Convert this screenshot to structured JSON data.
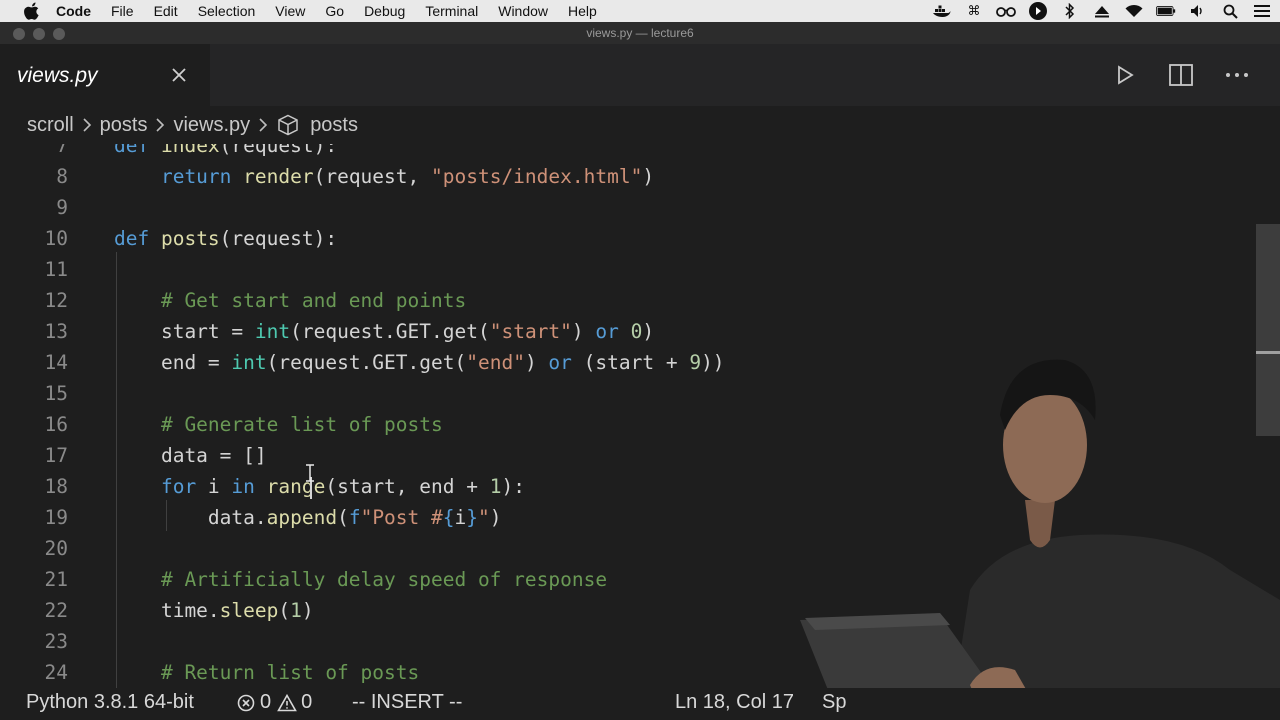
{
  "menubar": {
    "app_name": "Code",
    "items": [
      "File",
      "Edit",
      "Selection",
      "View",
      "Go",
      "Debug",
      "Terminal",
      "Window",
      "Help"
    ],
    "status_icons": [
      "docker-icon",
      "command-icon",
      "glasses-icon",
      "media-play-icon",
      "bluetooth-icon",
      "airplay-icon",
      "wifi-icon",
      "battery-icon",
      "volume-icon",
      "search-icon",
      "list-icon"
    ]
  },
  "window": {
    "title": "views.py — lecture6"
  },
  "tab": {
    "label": "views.py"
  },
  "breadcrumb": {
    "items": [
      "scroll",
      "posts",
      "views.py",
      "posts"
    ]
  },
  "editor": {
    "lines": [
      {
        "num": "7",
        "tokens": [
          [
            "kw",
            "def "
          ],
          [
            "fn",
            "index"
          ],
          [
            "",
            "(request):"
          ]
        ]
      },
      {
        "num": "8",
        "tokens": [
          [
            "kw",
            "    return "
          ],
          [
            "fn",
            "render"
          ],
          [
            "",
            "(request, "
          ],
          [
            "str",
            "\"posts/index.html\""
          ],
          [
            "",
            ")"
          ]
        ]
      },
      {
        "num": "9",
        "tokens": []
      },
      {
        "num": "10",
        "tokens": [
          [
            "kw",
            "def "
          ],
          [
            "fn",
            "posts"
          ],
          [
            "",
            "(request):"
          ]
        ]
      },
      {
        "num": "11",
        "tokens": []
      },
      {
        "num": "12",
        "tokens": [
          [
            "cmt",
            "    # Get start and end points"
          ]
        ]
      },
      {
        "num": "13",
        "tokens": [
          [
            "",
            "    start = "
          ],
          [
            "bi",
            "int"
          ],
          [
            "",
            "(request.GET.get("
          ],
          [
            "str",
            "\"start\""
          ],
          [
            "",
            ") "
          ],
          [
            "kw",
            "or"
          ],
          [
            "",
            " "
          ],
          [
            "num",
            "0"
          ],
          [
            "",
            ")"
          ]
        ]
      },
      {
        "num": "14",
        "tokens": [
          [
            "",
            "    end = "
          ],
          [
            "bi",
            "int"
          ],
          [
            "",
            "(request.GET.get("
          ],
          [
            "str",
            "\"end\""
          ],
          [
            "",
            ") "
          ],
          [
            "kw",
            "or"
          ],
          [
            "",
            " (start + "
          ],
          [
            "num",
            "9"
          ],
          [
            "",
            "))"
          ]
        ]
      },
      {
        "num": "15",
        "tokens": []
      },
      {
        "num": "16",
        "tokens": [
          [
            "cmt",
            "    # Generate list of posts"
          ]
        ]
      },
      {
        "num": "17",
        "tokens": [
          [
            "",
            "    data = []"
          ]
        ]
      },
      {
        "num": "18",
        "tokens": [
          [
            "kw",
            "    for"
          ],
          [
            "",
            " i "
          ],
          [
            "kw",
            "in"
          ],
          [
            "",
            " "
          ],
          [
            "fn",
            "range"
          ],
          [
            "",
            "(start, end + "
          ],
          [
            "num",
            "1"
          ],
          [
            "",
            "):"
          ]
        ]
      },
      {
        "num": "19",
        "tokens": [
          [
            "",
            "        data."
          ],
          [
            "fn",
            "append"
          ],
          [
            "",
            "("
          ],
          [
            "kw",
            "f"
          ],
          [
            "str",
            "\"Post #"
          ],
          [
            "kw",
            "{"
          ],
          [
            "",
            "i"
          ],
          [
            "kw",
            "}"
          ],
          [
            "str",
            "\""
          ],
          [
            "",
            ")"
          ]
        ]
      },
      {
        "num": "20",
        "tokens": []
      },
      {
        "num": "21",
        "tokens": [
          [
            "cmt",
            "    # Artificially delay speed of response"
          ]
        ]
      },
      {
        "num": "22",
        "tokens": [
          [
            "",
            "    time."
          ],
          [
            "fn",
            "sleep"
          ],
          [
            "",
            "("
          ],
          [
            "num",
            "1"
          ],
          [
            "",
            ")"
          ]
        ]
      },
      {
        "num": "23",
        "tokens": []
      },
      {
        "num": "24",
        "tokens": [
          [
            "cmt",
            "    # Return list of posts"
          ]
        ]
      }
    ]
  },
  "statusbar": {
    "interpreter": "Python 3.8.1 64-bit",
    "errors": "0",
    "warnings": "0",
    "mode": "-- INSERT --",
    "position": "Ln 18, Col 17",
    "spaces": "Sp"
  }
}
